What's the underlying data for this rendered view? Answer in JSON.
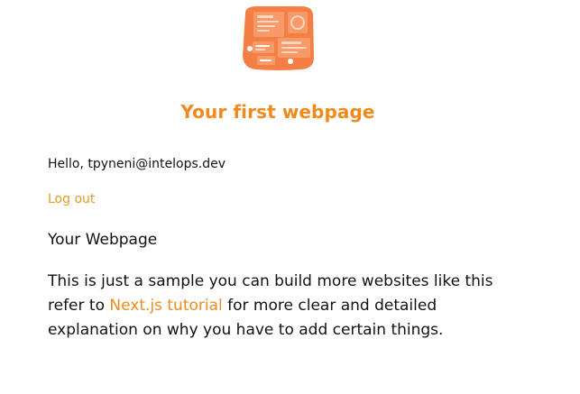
{
  "header": {
    "illustration_icon": "analytics-dashboard-illustration-icon",
    "title": "Your first webpage"
  },
  "account": {
    "greeting": "Hello, tpyneni@intelops.dev",
    "logout_label": "Log out"
  },
  "content": {
    "heading": "Your Webpage",
    "description_before_link": "This is just a sample you can build more websites like this refer to ",
    "link_label": "Next.js tutorial",
    "description_after_link": " for more clear and detailed explanation on why you have to add certain things."
  },
  "colors": {
    "accent": "#f08a1c",
    "link": "#e39b22",
    "illustration_orange": "#f47f45"
  }
}
